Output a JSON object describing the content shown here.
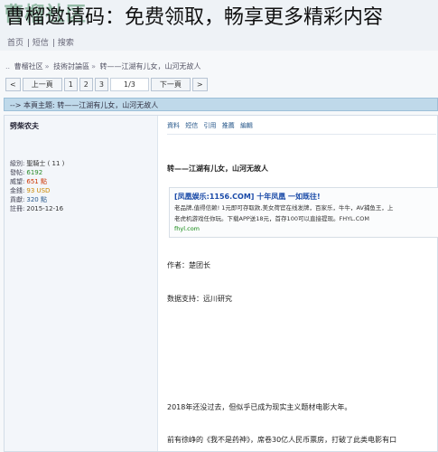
{
  "overlay": {
    "banner_text": "曹榴邀请码：免费领取，畅享更多精彩内容",
    "logo_text": "曹榴社区"
  },
  "top_links": [
    "首页",
    "短信",
    "搜索"
  ],
  "breadcrumb": [
    "曹榴社区",
    "技術討論區",
    "转——江湖有儿女，山河无故人"
  ],
  "pager": {
    "first": "<",
    "prev": "上一頁",
    "pages": [
      "1",
      "2",
      "3"
    ],
    "current": "1/3",
    "next": "下一頁",
    "last": ">"
  },
  "title_bar": "--> 本頁主題: 转——江湖有儿女，山河无故人",
  "post": {
    "author": "劈柴农夫",
    "stats": [
      {
        "label": "級別:",
        "value": "聖騎士 ( 11 )",
        "color": "#333333"
      },
      {
        "label": "發帖:",
        "value": "6192",
        "color": "#2a8a2a"
      },
      {
        "label": "威望:",
        "value": "651 點",
        "color": "#cc3300"
      },
      {
        "label": "金錢:",
        "value": "93 USD",
        "color": "#cc8800"
      },
      {
        "label": "貢獻:",
        "value": "320 點",
        "color": "#2a5a8c"
      },
      {
        "label": "註冊:",
        "value": "2015-12-16",
        "color": "#333333"
      }
    ],
    "actions": [
      "資料",
      "短信",
      "引用",
      "推薦",
      "編輯"
    ],
    "title": "转——江湖有儿女，山河无故人",
    "ad": {
      "title": "[凤凰娱乐:1156.COM] 十年凤凰 一如既往!",
      "line1": "老品牌,值得信赖! 1元即可存取款,美女荷官在线发牌，百家乐，牛牛，AV捕鱼王，上",
      "line2": "老虎机游戏任你玩。下载APP送18元，首存100可以直接提现。FHYL.COM",
      "link": "fhyl.com"
    },
    "author_line": "作者：楚团长",
    "support_line": "数据支持：远川研究",
    "body_line1": "2018年还没过去，但似乎已成为现实主义题材电影大年。",
    "body_line2": "前有徐峥的《我不是药神》，席卷30亿人民币票房，打破了此类电影有口"
  }
}
